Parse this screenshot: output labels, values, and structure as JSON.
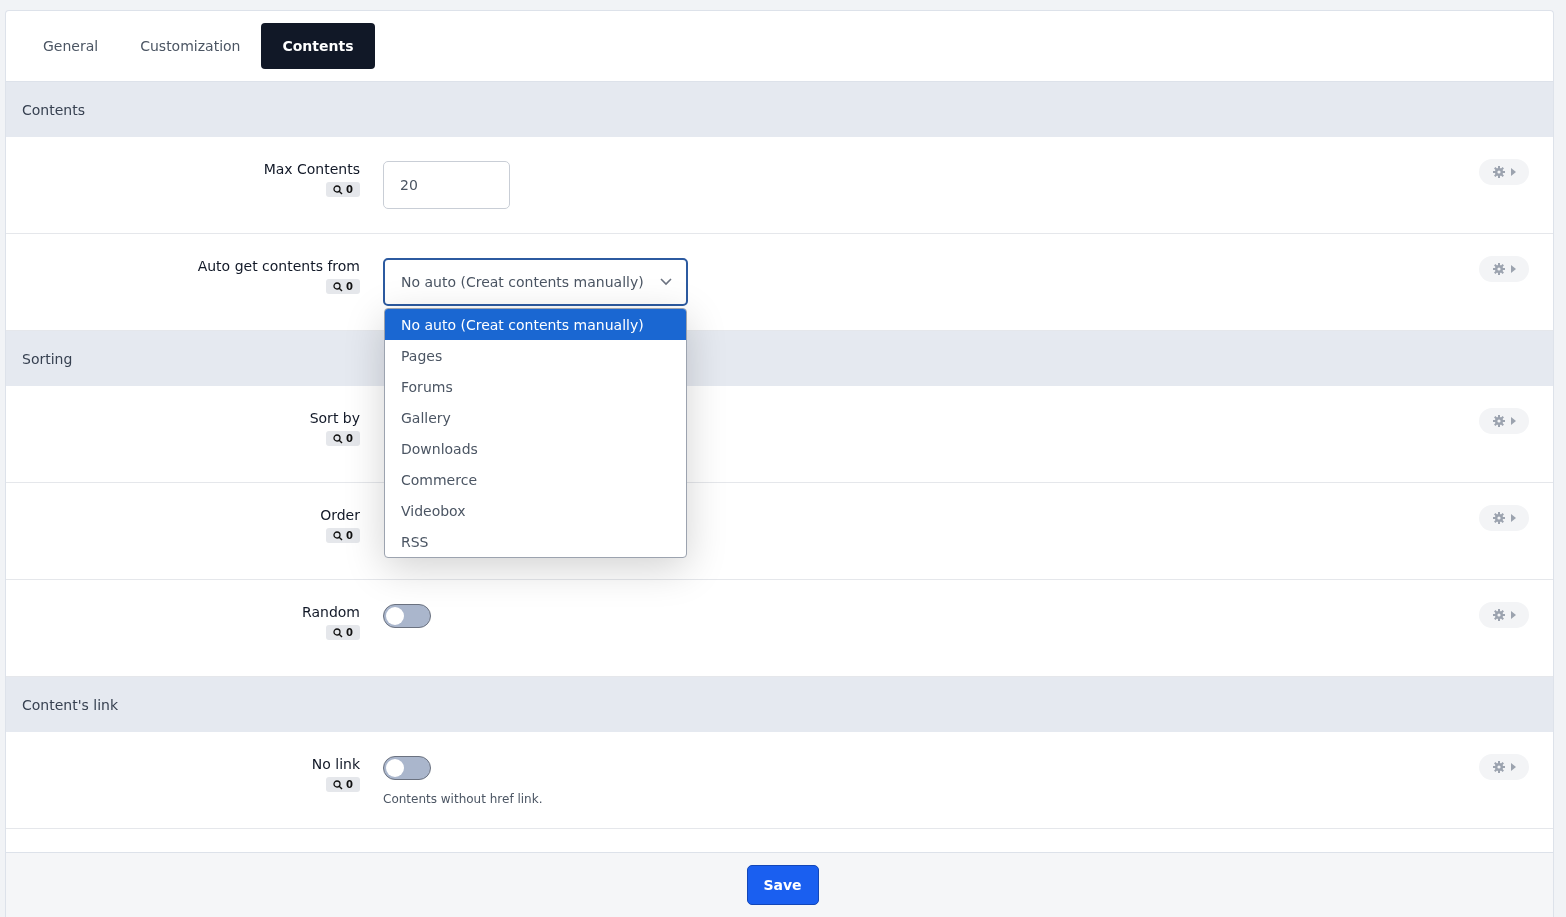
{
  "tabs": [
    {
      "label": "General",
      "selected": false
    },
    {
      "label": "Customization",
      "selected": false
    },
    {
      "label": "Contents",
      "selected": true
    }
  ],
  "sections": [
    {
      "title": "Contents",
      "rows": [
        {
          "label": "Max Contents",
          "badge": "0",
          "kind": "number",
          "value": "20"
        },
        {
          "label": "Auto get contents from",
          "badge": "0",
          "kind": "select",
          "value": "No auto (Creat contents manually)",
          "expanded": true,
          "options": [
            {
              "label": "No auto (Creat contents manually)",
              "selected": true
            },
            {
              "label": "Pages",
              "selected": false
            },
            {
              "label": "Forums",
              "selected": false
            },
            {
              "label": "Gallery",
              "selected": false
            },
            {
              "label": "Downloads",
              "selected": false
            },
            {
              "label": "Commerce",
              "selected": false
            },
            {
              "label": "Videobox",
              "selected": false
            },
            {
              "label": "RSS",
              "selected": false
            }
          ]
        }
      ]
    },
    {
      "title": "Sorting",
      "rows": [
        {
          "label": "Sort by",
          "badge": "0",
          "kind": "covered"
        },
        {
          "label": "Order",
          "badge": "0",
          "kind": "covered"
        },
        {
          "label": "Random",
          "badge": "0",
          "kind": "toggle",
          "on": false
        }
      ]
    },
    {
      "title": "Content's link",
      "rows": [
        {
          "label": "No link",
          "badge": "0",
          "kind": "toggle",
          "on": false,
          "hint": "Contents without href link."
        }
      ]
    }
  ],
  "save": "Save"
}
